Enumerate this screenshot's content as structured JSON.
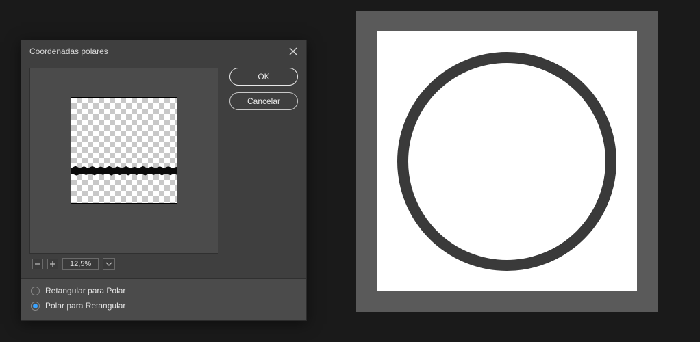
{
  "dialog": {
    "title": "Coordenadas polares",
    "ok_label": "OK",
    "cancel_label": "Cancelar",
    "zoom_value": "12,5%",
    "options": {
      "rect_to_polar": "Retangular para Polar",
      "polar_to_rect": "Polar para Retangular",
      "selected": "polar_to_rect"
    }
  },
  "icons": {
    "close": "close-icon",
    "minus": "zoom-out-icon",
    "plus": "zoom-in-icon",
    "chevron": "chevron-down-icon"
  }
}
